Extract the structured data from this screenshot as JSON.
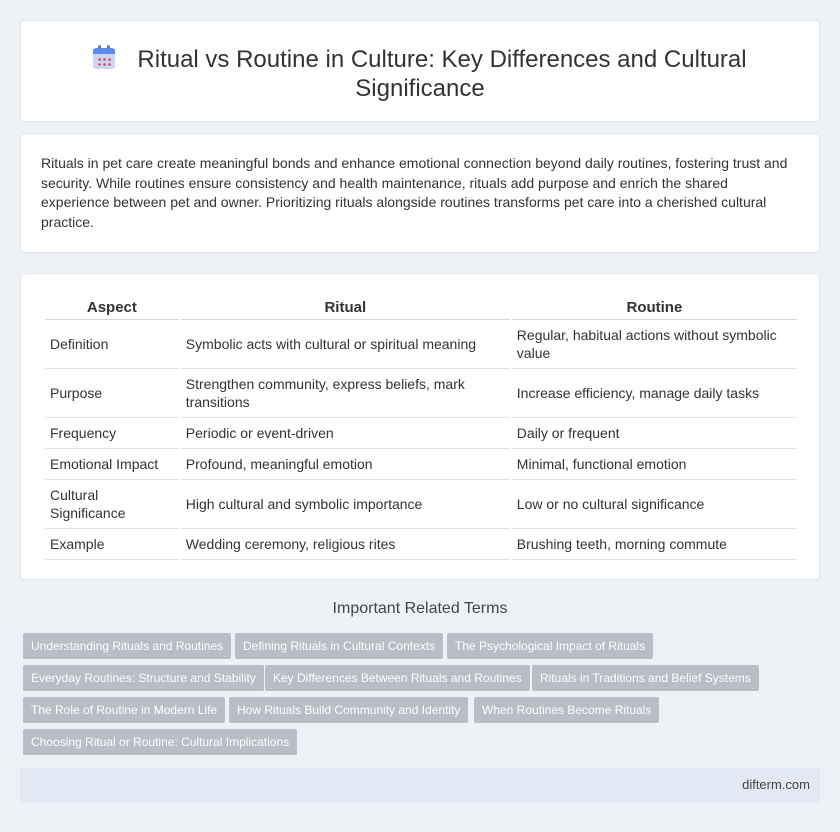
{
  "header": {
    "title": "Ritual vs Routine in Culture: Key Differences and Cultural Significance"
  },
  "summary": "Rituals in pet care create meaningful bonds and enhance emotional connection beyond daily routines, fostering trust and security. While routines ensure consistency and health maintenance, rituals add purpose and enrich the shared experience between pet and owner. Prioritizing rituals alongside routines transforms pet care into a cherished cultural practice.",
  "table": {
    "headers": [
      "Aspect",
      "Ritual",
      "Routine"
    ],
    "rows": [
      [
        "Definition",
        "Symbolic acts with cultural or spiritual meaning",
        "Regular, habitual actions without symbolic value"
      ],
      [
        "Purpose",
        "Strengthen community, express beliefs, mark transitions",
        "Increase efficiency, manage daily tasks"
      ],
      [
        "Frequency",
        "Periodic or event-driven",
        "Daily or frequent"
      ],
      [
        "Emotional Impact",
        "Profound, meaningful emotion",
        "Minimal, functional emotion"
      ],
      [
        "Cultural Significance",
        "High cultural and symbolic importance",
        "Low or no cultural significance"
      ],
      [
        "Example",
        "Wedding ceremony, religious rites",
        "Brushing teeth, morning commute"
      ]
    ]
  },
  "related": {
    "title": "Important Related Terms",
    "tags": [
      "Understanding Rituals and Routines",
      "Defining Rituals in Cultural Contexts",
      "The Psychological Impact of Rituals",
      "Everyday Routines: Structure and Stability",
      "Key Differences Between Rituals and Routines",
      "Rituals in Traditions and Belief Systems",
      "The Role of Routine in Modern Life",
      "How Rituals Build Community and Identity",
      "When Routines Become Rituals",
      "Choosing Ritual or Routine: Cultural Implications"
    ]
  },
  "footer": {
    "site": "difterm.com"
  },
  "icons": {
    "title_icon": "calendar-icon"
  },
  "colors": {
    "tag_bg": "#b8bec6",
    "page_bg": "#eef2f7",
    "footer_bg": "#e3e9f4"
  }
}
